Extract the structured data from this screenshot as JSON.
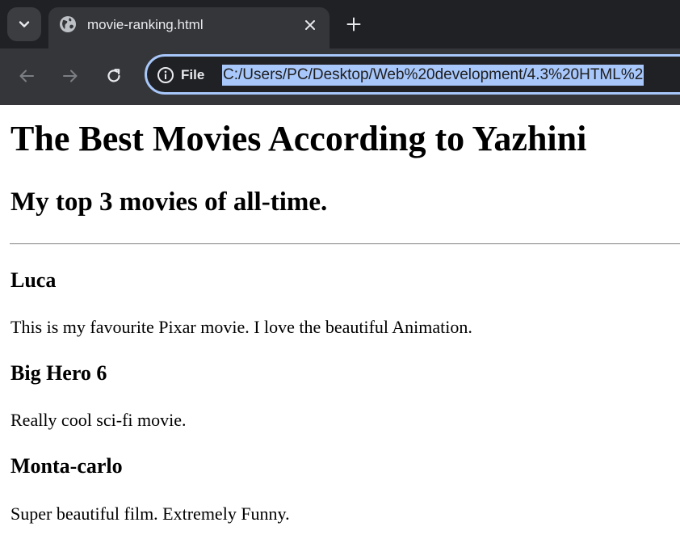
{
  "browser": {
    "tab": {
      "title": "movie-ranking.html"
    },
    "address_bar": {
      "site_info_label": "File",
      "url": "C:/Users/PC/Desktop/Web%20development/4.3%20HTML%2"
    },
    "colors": {
      "frame": "#202124",
      "toolbar": "#35363a",
      "selection": "#a8c7fa"
    }
  },
  "page": {
    "heading": "The Best Movies According to Yazhini",
    "subheading": "My top 3 movies of all-time.",
    "movies": [
      {
        "title": "Luca",
        "description": "This is my favourite Pixar movie. I love the beautiful Animation."
      },
      {
        "title": "Big Hero 6",
        "description": "Really cool sci-fi movie."
      },
      {
        "title": "Monta-carlo",
        "description": "Super beautiful film. Extremely Funny."
      }
    ]
  }
}
